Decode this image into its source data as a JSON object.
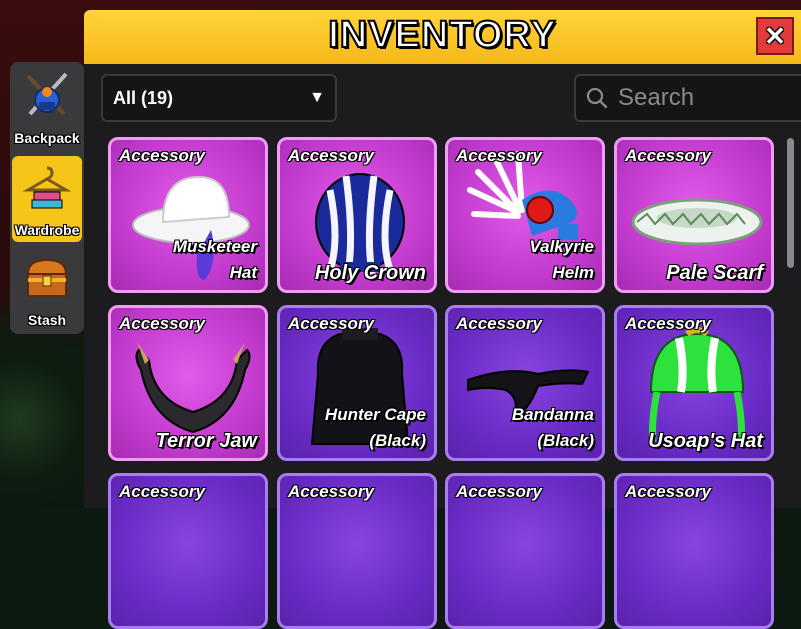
{
  "window": {
    "title": "INVENTORY",
    "close_label": "✕"
  },
  "sidenav": [
    {
      "label": "Backpack",
      "icon": "backpack-icon",
      "active": false
    },
    {
      "label": "Wardrobe",
      "icon": "wardrobe-hanger-icon",
      "active": true
    },
    {
      "label": "Stash",
      "icon": "treasure-chest-icon",
      "active": false
    }
  ],
  "filter": {
    "selected": "All (19)",
    "caret": "▼"
  },
  "search": {
    "placeholder": "Search",
    "value": ""
  },
  "items": [
    {
      "type": "Accessory",
      "name": "Musketeer\nHat",
      "rarity": "pink",
      "icon": "musketeer-hat-icon"
    },
    {
      "type": "Accessory",
      "name": "Holy Crown",
      "rarity": "pink",
      "icon": "holy-crown-icon"
    },
    {
      "type": "Accessory",
      "name": "Valkyrie\nHelm",
      "rarity": "pink",
      "icon": "valkyrie-helm-icon"
    },
    {
      "type": "Accessory",
      "name": "Pale Scarf",
      "rarity": "pink",
      "icon": "pale-scarf-icon"
    },
    {
      "type": "Accessory",
      "name": "Terror Jaw",
      "rarity": "pink",
      "icon": "terror-jaw-icon"
    },
    {
      "type": "Accessory",
      "name": "Hunter Cape\n(Black)",
      "rarity": "purple",
      "icon": "hunter-cape-icon"
    },
    {
      "type": "Accessory",
      "name": "Bandanna\n(Black)",
      "rarity": "purple",
      "icon": "bandanna-icon"
    },
    {
      "type": "Accessory",
      "name": "Usoap's Hat",
      "rarity": "purple",
      "icon": "usoap-hat-icon"
    },
    {
      "type": "Accessory",
      "name": "",
      "rarity": "purple",
      "icon": ""
    },
    {
      "type": "Accessory",
      "name": "",
      "rarity": "purple",
      "icon": ""
    },
    {
      "type": "Accessory",
      "name": "",
      "rarity": "purple",
      "icon": ""
    },
    {
      "type": "Accessory",
      "name": "",
      "rarity": "purple",
      "icon": ""
    }
  ],
  "colors": {
    "title_bar": "#f6b81a",
    "close": "#e33b3b",
    "legendary": "#c43ccf",
    "epic": "#6a2bc6",
    "active_tab": "#f5c518"
  }
}
